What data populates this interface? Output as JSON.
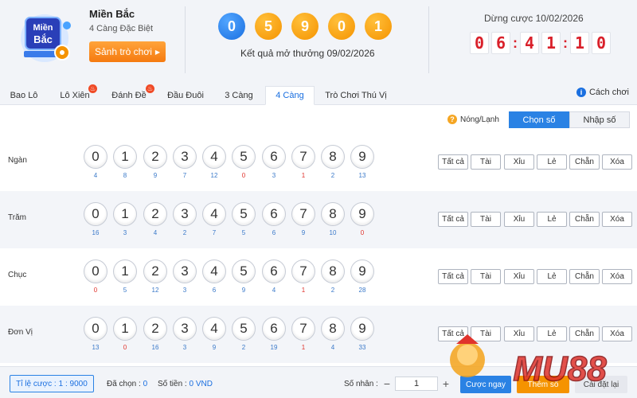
{
  "header": {
    "logo_text": [
      "Miền",
      "Bắc"
    ],
    "region_title": "Miền Bắc",
    "region_sub": "4 Càng Đặc Biệt",
    "lobby_button": "Sảnh trò chơi",
    "result_digits": [
      "0",
      "5",
      "9",
      "0",
      "1"
    ],
    "result_label": "Kết quả mở thưởng 09/02/2026",
    "stop_label": "Dừng cược 10/02/2026",
    "countdown": [
      "0",
      "6",
      "4",
      "1",
      "1",
      "0"
    ]
  },
  "tabs": [
    {
      "label": "Bao Lô",
      "hot": false,
      "active": false
    },
    {
      "label": "Lô Xiên",
      "hot": true,
      "active": false
    },
    {
      "label": "Đánh Đề",
      "hot": true,
      "active": false
    },
    {
      "label": "Đầu Đuôi",
      "hot": false,
      "active": false
    },
    {
      "label": "3 Càng",
      "hot": false,
      "active": false
    },
    {
      "label": "4 Càng",
      "hot": false,
      "active": true
    },
    {
      "label": "Trò Chơi Thú Vị",
      "hot": false,
      "active": false
    }
  ],
  "howto": "Cách chơi",
  "mode": {
    "hot_cold": "Nóng/Lạnh",
    "pick": "Chọn số",
    "input": "Nhập số"
  },
  "digits": [
    "0",
    "1",
    "2",
    "3",
    "4",
    "5",
    "6",
    "7",
    "8",
    "9"
  ],
  "quick_buttons": [
    "Tất cả",
    "Tài",
    "Xỉu",
    "Lẻ",
    "Chẵn",
    "Xóa"
  ],
  "rows": [
    {
      "label": "Ngàn",
      "missing": [
        "4",
        "8",
        "9",
        "7",
        "12",
        "0",
        "3",
        "1",
        "2",
        "13"
      ]
    },
    {
      "label": "Trăm",
      "missing": [
        "16",
        "3",
        "4",
        "2",
        "7",
        "5",
        "6",
        "9",
        "10",
        "0"
      ]
    },
    {
      "label": "Chục",
      "missing": [
        "0",
        "5",
        "12",
        "3",
        "6",
        "9",
        "4",
        "1",
        "2",
        "28"
      ]
    },
    {
      "label": "Đơn Vị",
      "missing": [
        "13",
        "0",
        "16",
        "3",
        "9",
        "2",
        "19",
        "1",
        "4",
        "33"
      ]
    }
  ],
  "footer": {
    "odds_label": "Tỉ lệ cược :",
    "odds_value": "1 : 9000",
    "selected_label": "Đã chọn :",
    "selected_value": "0",
    "amount_label": "Số tiền :",
    "amount_value": "0 VND",
    "multiplier_label": "Số nhân :",
    "multiplier_value": "1",
    "bet_now": "Cược ngay",
    "add_more": "Thêm số",
    "reset": "Cài đặt lại"
  },
  "watermark_text": "MU88",
  "colors": {
    "accent": "#2a82e4",
    "orange": "#f59300",
    "red": "#e0332c"
  }
}
